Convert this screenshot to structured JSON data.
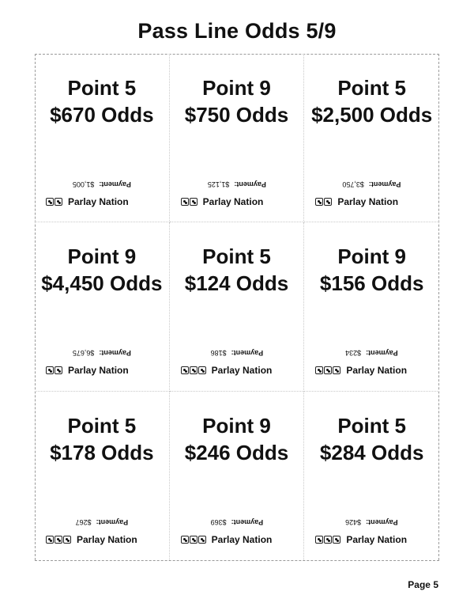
{
  "page": {
    "title": "Pass Line Odds 5/9",
    "page_number": "Page 5"
  },
  "cards": [
    {
      "point": "Point 5",
      "odds": "$670 Odds",
      "payment_label": "Payment:",
      "payment_value": "$1,005",
      "brand": "Parlay Nation",
      "dice_icons": [
        "dice-icon",
        "dice-icon"
      ]
    },
    {
      "point": "Point 9",
      "odds": "$750 Odds",
      "payment_label": "Payment:",
      "payment_value": "$1,125",
      "brand": "Parlay Nation",
      "dice_icons": [
        "dice-icon",
        "dice-icon"
      ]
    },
    {
      "point": "Point 5",
      "odds": "$2,500 Odds",
      "payment_label": "Payment:",
      "payment_value": "$3,750",
      "brand": "Parlay Nation",
      "dice_icons": [
        "dice-icon",
        "dice-icon"
      ]
    },
    {
      "point": "Point 9",
      "odds": "$4,450 Odds",
      "payment_label": "Payment:",
      "payment_value": "$6,675",
      "brand": "Parlay Nation",
      "dice_icons": [
        "dice-icon",
        "dice-icon"
      ]
    },
    {
      "point": "Point 5",
      "odds": "$124 Odds",
      "payment_label": "Payment:",
      "payment_value": "$186",
      "brand": "Parlay Nation",
      "dice_icons": [
        "dice-icon",
        "dice-icon",
        "dice-icon"
      ]
    },
    {
      "point": "Point 9",
      "odds": "$156 Odds",
      "payment_label": "Payment:",
      "payment_value": "$234",
      "brand": "Parlay Nation",
      "dice_icons": [
        "dice-icon",
        "dice-icon",
        "dice-icon"
      ]
    },
    {
      "point": "Point 5",
      "odds": "$178 Odds",
      "payment_label": "Payment:",
      "payment_value": "$267",
      "brand": "Parlay Nation",
      "dice_icons": [
        "dice-icon",
        "dice-icon",
        "dice-icon"
      ]
    },
    {
      "point": "Point 9",
      "odds": "$246 Odds",
      "payment_label": "Payment:",
      "payment_value": "$369",
      "brand": "Parlay Nation",
      "dice_icons": [
        "dice-icon",
        "dice-icon",
        "dice-icon"
      ]
    },
    {
      "point": "Point 5",
      "odds": "$284 Odds",
      "payment_label": "Payment:",
      "payment_value": "$426",
      "brand": "Parlay Nation",
      "dice_icons": [
        "dice-icon",
        "dice-icon",
        "dice-icon"
      ]
    }
  ]
}
